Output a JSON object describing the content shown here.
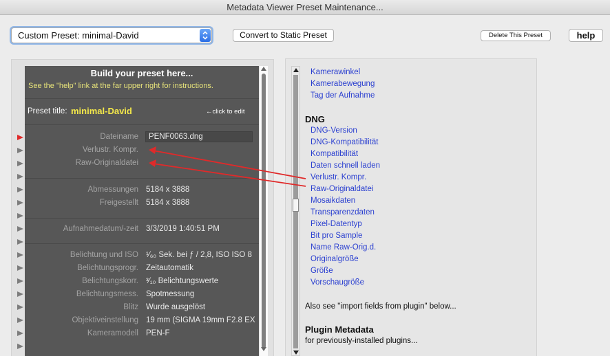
{
  "window": {
    "title": "Metadata Viewer Preset Maintenance..."
  },
  "toolbar": {
    "preset_select_value": "Custom Preset: minimal-David",
    "convert_label": "Convert to Static Preset",
    "delete_label": "Delete This Preset",
    "help_label": "help"
  },
  "builder": {
    "heading": "Build your preset here...",
    "instructions": "See the \"help\" link at the far upper right for instructions.",
    "preset_title_label": "Preset title:",
    "preset_title_value": "minimal-David",
    "click_to_edit": "←click to edit",
    "rows": [
      {
        "label": "Dateiname",
        "value": "PENF0063.dng"
      },
      {
        "label": "Verlustr. Kompr.",
        "value": ""
      },
      {
        "label": "Raw-Originaldatei",
        "value": ""
      },
      {
        "label": "Abmessungen",
        "value": "5184 x 3888"
      },
      {
        "label": "Freigestellt",
        "value": "5184 x 3888"
      },
      {
        "label": "Aufnahmedatum/-zeit",
        "value": "3/3/2019 1:40:51 PM"
      },
      {
        "label": "Belichtung und ISO",
        "value": "¹⁄₆₀ Sek. bei ƒ / 2,8, ISO ISO 8"
      },
      {
        "label": "Belichtungsprogr.",
        "value": "Zeitautomatik"
      },
      {
        "label": "Belichtungskorr.",
        "value": "³⁄₁₀ Belichtungswerte"
      },
      {
        "label": "Belichtungsmess.",
        "value": "Spotmessung"
      },
      {
        "label": "Blitz",
        "value": "Wurde ausgelöst"
      },
      {
        "label": "Objektiveinstellung",
        "value": "19 mm (SIGMA 19mm F2.8 EX"
      },
      {
        "label": "Kameramodell",
        "value": "PEN-F"
      }
    ]
  },
  "fields": {
    "top_links": [
      "Kamerawinkel",
      "Kamerabewegung",
      "Tag der Aufnahme"
    ],
    "dng_heading": "DNG",
    "dng_links": [
      "DNG-Version",
      "DNG-Kompatibilität",
      "Kompatibilität",
      "Daten schnell laden",
      "Verlustr. Kompr.",
      "Raw-Originaldatei",
      "Mosaikdaten",
      "Transparenzdaten",
      "Pixel-Datentyp",
      "Bit pro Sample",
      "Name Raw-Orig.d.",
      "Originalgröße",
      "Größe",
      "Vorschaugröße"
    ],
    "also_see": "Also see \"import fields from plugin\" below...",
    "plugin_heading": "Plugin Metadata",
    "plugin_note": "for previously-installed plugins..."
  },
  "colors": {
    "link": "#2a3fd0",
    "preset_title": "#f4e84a",
    "instructions": "#e6e27a",
    "arrow": "#e02a2a",
    "builder_bg": "#575757"
  },
  "icons": {
    "row_marker": "triangle-right",
    "active_row_marker": "triangle-right-red",
    "select_stepper": "up-down-chevrons"
  }
}
